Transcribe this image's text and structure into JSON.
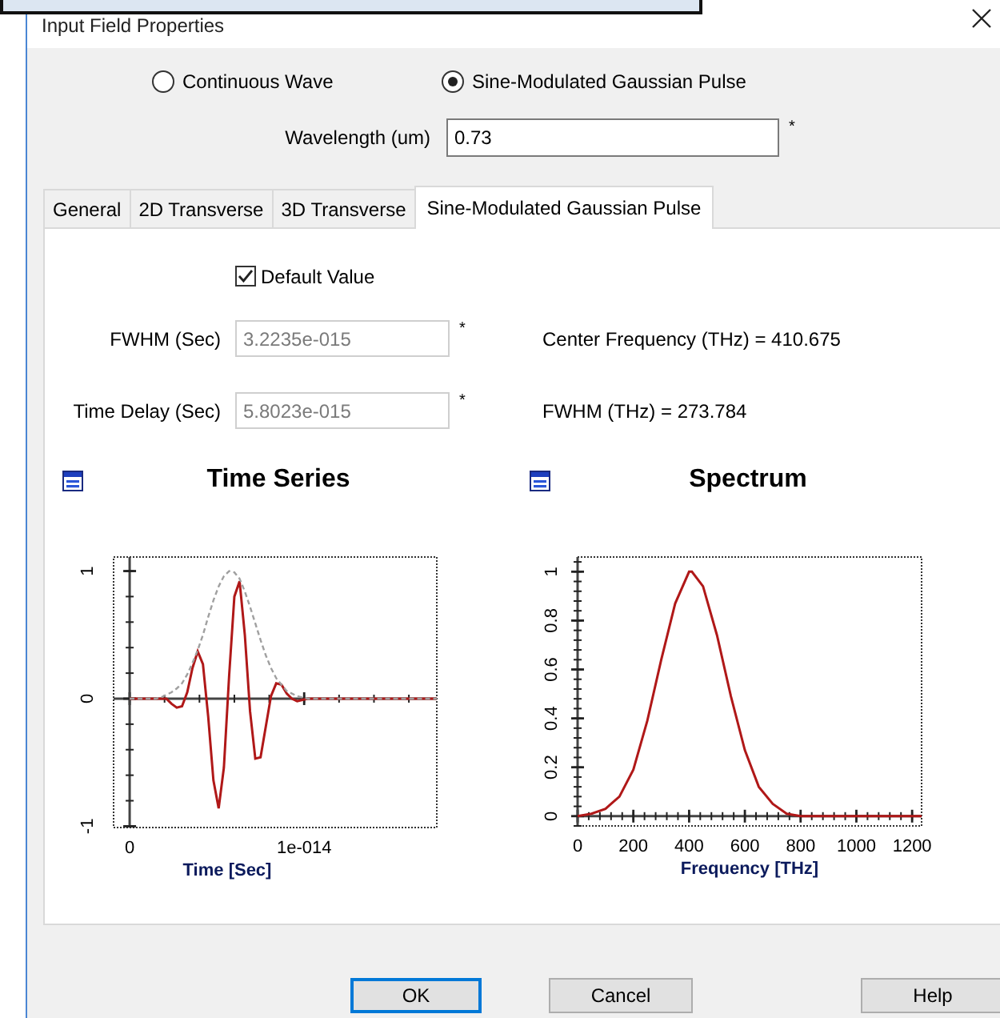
{
  "window": {
    "title": "Input Field Properties"
  },
  "source_type": [
    {
      "label": "Continuous Wave",
      "selected": false
    },
    {
      "label": "Sine-Modulated Gaussian Pulse",
      "selected": true
    }
  ],
  "wavelength": {
    "label": "Wavelength (um)",
    "value": "0.73",
    "mark": "*"
  },
  "tabs": [
    {
      "label": "General",
      "selected": false
    },
    {
      "label": "2D Transverse",
      "selected": false
    },
    {
      "label": "3D Transverse",
      "selected": false
    },
    {
      "label": "Sine-Modulated Gaussian Pulse",
      "selected": true
    }
  ],
  "default_value": {
    "label": "Default Value",
    "checked": true
  },
  "fields": [
    {
      "label": "FWHM (Sec)",
      "value": "3.2235e-015",
      "mark": "*",
      "disabled": true,
      "info": "Center Frequency (THz) = 410.675"
    },
    {
      "label": "Time Delay (Sec)",
      "value": "5.8023e-015",
      "mark": "*",
      "disabled": true,
      "info": "FWHM (THz) = 273.784"
    }
  ],
  "charts": [
    {
      "title": "Time Series",
      "chart_data": {
        "type": "line",
        "xlabel": "Time [Sec]",
        "x": [
          0,
          1.2e-15,
          1.5e-15,
          1.8e-15,
          2.1e-15,
          2.4e-15,
          2.7e-15,
          3e-15,
          3.3e-15,
          3.6e-15,
          3.9e-15,
          4.2e-15,
          4.5e-15,
          4.8e-15,
          5.1e-15,
          5.4e-15,
          5.7e-15,
          6e-15,
          6.3e-15,
          6.6e-15,
          6.9e-15,
          7.2e-15,
          7.5e-15,
          7.8e-15,
          8.1e-15,
          8.4e-15,
          8.7e-15,
          9e-15,
          9.3e-15,
          9.6e-15,
          9.9e-15,
          1.02e-14,
          1.05e-14,
          1.14e-14,
          1.3e-14,
          1.5e-14,
          1.76e-14
        ],
        "series": [
          {
            "color": "#b01818",
            "line_style": "solid",
            "values": [
              0,
              0,
              0,
              0,
              0,
              -0.04,
              -0.07,
              -0.06,
              0.05,
              0.24,
              0.37,
              0.27,
              -0.14,
              -0.64,
              -0.86,
              -0.54,
              0.18,
              0.8,
              0.92,
              0.5,
              -0.1,
              -0.47,
              -0.46,
              -0.22,
              0.02,
              0.12,
              0.11,
              0.04,
              0,
              -0.02,
              -0.01,
              0,
              0,
              0,
              0,
              0,
              0
            ]
          },
          {
            "color": "#a0a0a0",
            "line_style": "dashed",
            "values": [
              0,
              0,
              0,
              0.01,
              0.03,
              0.05,
              0.08,
              0.12,
              0.19,
              0.28,
              0.38,
              0.5,
              0.64,
              0.77,
              0.88,
              0.96,
              1,
              0.99,
              0.94,
              0.84,
              0.72,
              0.59,
              0.46,
              0.34,
              0.24,
              0.16,
              0.11,
              0.06,
              0.04,
              0.02,
              0.01,
              0,
              0,
              0,
              0,
              0,
              0
            ]
          }
        ],
        "xlim": [
          -9.2e-16,
          1.76e-14
        ],
        "ylim": [
          -1.01,
          1.11
        ],
        "xticks": [
          {
            "value": 0,
            "label": "0"
          },
          {
            "value": 1e-14,
            "label": "1e-014"
          }
        ],
        "yticks": [
          -1,
          0,
          1
        ]
      }
    },
    {
      "title": "Spectrum",
      "chart_data": {
        "type": "line",
        "xlabel": "Frequency [THz]",
        "x": [
          0,
          50,
          100,
          150,
          200,
          250,
          300,
          350,
          400,
          410,
          450,
          500,
          550,
          600,
          650,
          700,
          750,
          800,
          850,
          900,
          1000,
          1100,
          1234
        ],
        "series": [
          {
            "color": "#b01818",
            "line_style": "solid",
            "values": [
              0,
              0.01,
              0.03,
              0.08,
              0.19,
              0.39,
              0.64,
              0.87,
              1,
              1,
              0.94,
              0.74,
              0.49,
              0.27,
              0.12,
              0.05,
              0.01,
              0,
              0,
              0,
              0,
              0,
              0
            ]
          }
        ],
        "xlim": [
          0,
          1234
        ],
        "ylim": [
          -0.04,
          1.06
        ],
        "xticks": [
          0,
          200,
          400,
          600,
          800,
          1000,
          1200
        ],
        "yticks": [
          0,
          0.2,
          0.4,
          0.6,
          0.8,
          1
        ]
      }
    }
  ],
  "buttons": [
    {
      "label": "OK",
      "default": true
    },
    {
      "label": "Cancel",
      "default": false
    },
    {
      "label": "Help",
      "default": false
    }
  ]
}
